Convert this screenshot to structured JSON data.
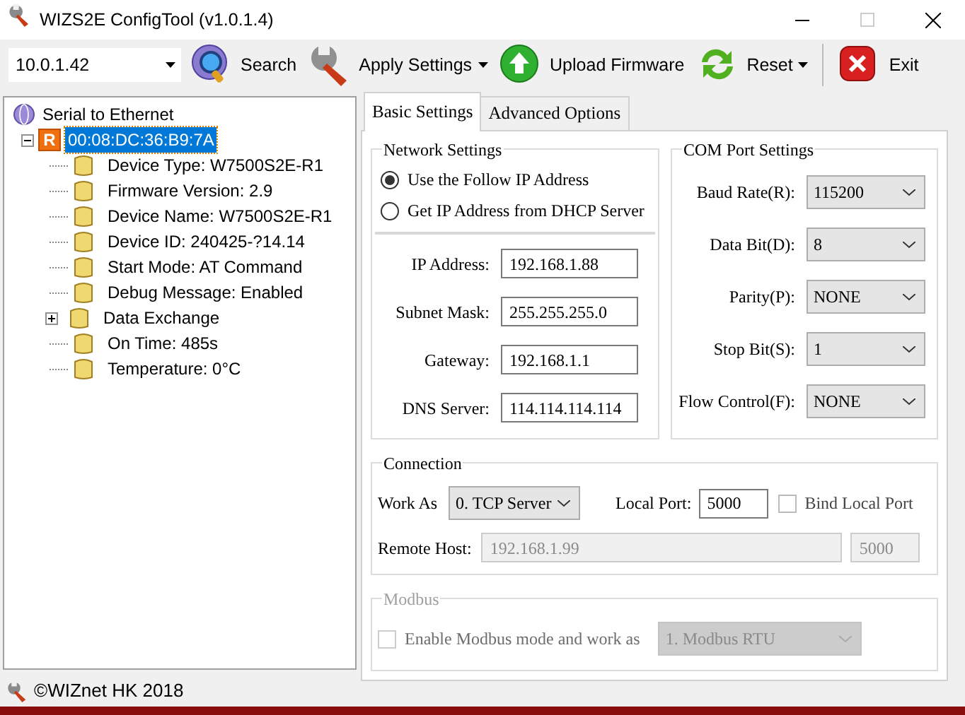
{
  "window": {
    "title": "WIZS2E ConfigTool (v1.0.1.4)"
  },
  "toolbar": {
    "address": "10.0.1.42",
    "buttons": [
      {
        "label": "Search",
        "kind": "search",
        "dropdown": false
      },
      {
        "label": "Apply Settings",
        "kind": "wrench",
        "dropdown": true
      },
      {
        "label": "Upload Firmware",
        "kind": "upload",
        "dropdown": false
      },
      {
        "label": "Reset",
        "kind": "reset",
        "dropdown": true
      },
      {
        "label": "Exit",
        "kind": "exit",
        "dropdown": false
      }
    ]
  },
  "tree": {
    "label": "Serial to Ethernet",
    "children": [
      {
        "label": "00:08:DC:36:B9:7A",
        "badge": "R",
        "selected": true,
        "expanded": true,
        "children": [
          {
            "label": "Device Type: W7500S2E-R1"
          },
          {
            "label": "Firmware Version: 2.9"
          },
          {
            "label": "Device Name: W7500S2E-R1"
          },
          {
            "label": "Device ID: 240425-?14.14"
          },
          {
            "label": "Start Mode: AT Command"
          },
          {
            "label": "Debug Message: Enabled"
          },
          {
            "label": "Data Exchange",
            "expanded": false
          },
          {
            "label": "On Time: 485s"
          },
          {
            "label": "Temperature: 0°C"
          }
        ]
      }
    ]
  },
  "tabs": [
    {
      "label": "Basic Settings",
      "selected": true
    },
    {
      "label": "Advanced Options",
      "selected": false
    }
  ],
  "network_settings": {
    "title": "Network Settings",
    "ip_modes": [
      {
        "label": "Use the Follow IP Address",
        "selected": true
      },
      {
        "label": "Get IP Address from DHCP Server",
        "selected": false
      }
    ],
    "fields": [
      {
        "label": "IP Address:",
        "value": "192.168.1.88"
      },
      {
        "label": "Subnet Mask:",
        "value": "255.255.255.0"
      },
      {
        "label": "Gateway:",
        "value": "192.168.1.1"
      },
      {
        "label": "DNS Server:",
        "value": "114.114.114.114"
      }
    ]
  },
  "com_port": {
    "title": "COM Port Settings",
    "fields": [
      {
        "label": "Baud Rate(R):",
        "value": "115200"
      },
      {
        "label": "Data Bit(D):",
        "value": "8"
      },
      {
        "label": "Parity(P):",
        "value": "NONE"
      },
      {
        "label": "Stop Bit(S):",
        "value": "1"
      },
      {
        "label": "Flow Control(F):",
        "value": "NONE"
      }
    ]
  },
  "connection": {
    "title": "Connection",
    "work_as": {
      "label": "Work As",
      "value": "0. TCP Server"
    },
    "local_port": {
      "label": "Local Port:",
      "value": "5000"
    },
    "bind_local_port": {
      "label": "Bind Local Port",
      "checked": false
    },
    "remote_host": {
      "label": "Remote Host:",
      "value": "192.168.1.99",
      "port": "5000",
      "disabled": true
    }
  },
  "modbus": {
    "title": "Modbus",
    "disabled": true,
    "enable": {
      "label": "Enable Modbus mode and work as",
      "checked": false
    },
    "mode": "1. Modbus RTU"
  },
  "status_bar": {
    "text": "©WIZnet HK 2018"
  }
}
